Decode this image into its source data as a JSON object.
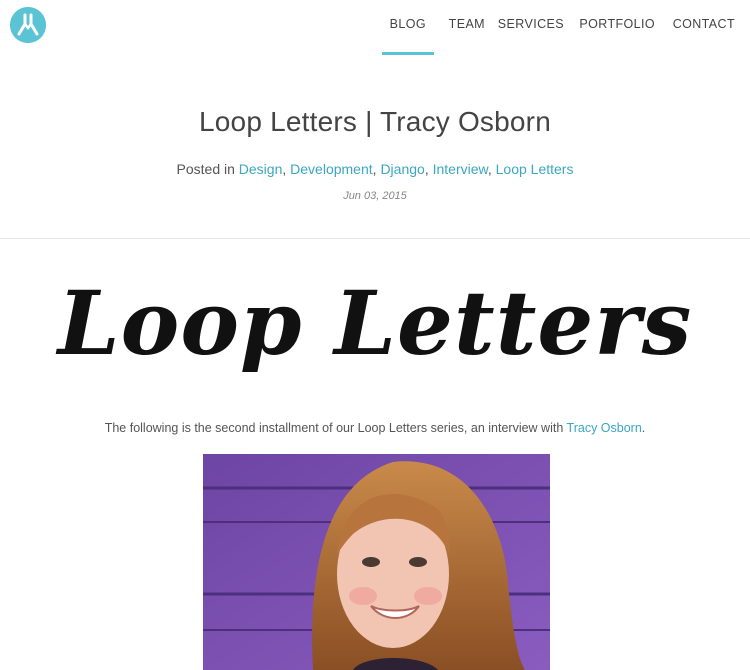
{
  "header": {
    "logo_icon": "rocket-logo-icon",
    "nav": [
      {
        "label": "BLOG",
        "active": true
      },
      {
        "label": "TEAM"
      },
      {
        "label": "SERVICES"
      },
      {
        "label": "PORTFOLIO"
      },
      {
        "label": "CONTACT"
      }
    ]
  },
  "post": {
    "title": "Loop Letters | Tracy Osborn",
    "posted_in_prefix": "Posted in ",
    "categories": [
      "Design",
      "Development",
      "Django",
      "Interview",
      "Loop Letters"
    ],
    "date": "Jun 03, 2015",
    "hero_text": "Loop Letters",
    "intro_prefix": "The following is the second installment of our Loop Letters series, an interview with ",
    "intro_link": "Tracy Osborn",
    "intro_suffix": "."
  },
  "colors": {
    "accent": "#5bc4d4",
    "link": "#3ba7c1",
    "photo_background": "#7a4fa8"
  }
}
